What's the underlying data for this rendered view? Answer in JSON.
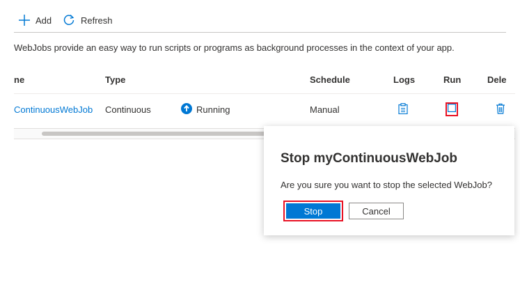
{
  "toolbar": {
    "add_label": "Add",
    "refresh_label": "Refresh"
  },
  "description": "WebJobs provide an easy way to run scripts or programs as background processes in the context of your app.",
  "table": {
    "headers": {
      "name": "ne",
      "type": "Type",
      "schedule": "Schedule",
      "logs": "Logs",
      "run": "Run",
      "delete": "Dele"
    },
    "rows": [
      {
        "name": "ContinuousWebJob",
        "type": "Continuous",
        "status": "Running",
        "schedule": "Manual"
      }
    ]
  },
  "confirm_dialog": {
    "title": "Stop myContinuousWebJob",
    "message": "Are you sure you want to stop the selected WebJob?",
    "confirm_label": "Stop",
    "cancel_label": "Cancel"
  },
  "colors": {
    "accent": "#0078d4",
    "highlight": "#e81123",
    "text": "#323130"
  }
}
